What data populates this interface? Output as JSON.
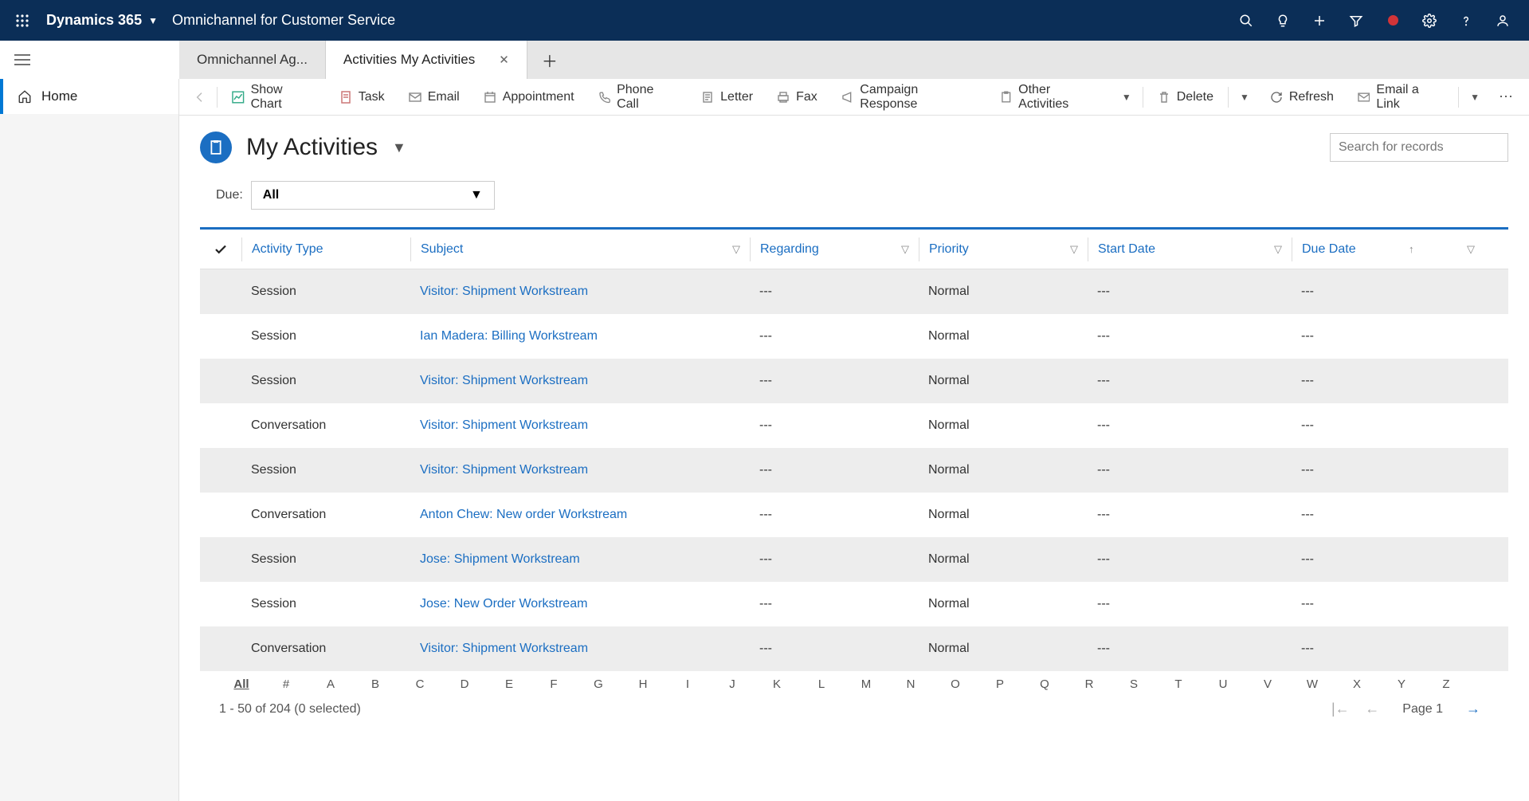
{
  "header": {
    "brand": "Dynamics 365",
    "app": "Omnichannel for Customer Service"
  },
  "tabs": {
    "inactive": "Omnichannel Ag...",
    "active": "Activities My Activities"
  },
  "sidebar": {
    "home": "Home"
  },
  "toolbar": {
    "showChart": "Show Chart",
    "task": "Task",
    "email": "Email",
    "appointment": "Appointment",
    "phoneCall": "Phone Call",
    "letter": "Letter",
    "fax": "Fax",
    "campaignResponse": "Campaign Response",
    "otherActivities": "Other Activities",
    "delete": "Delete",
    "refresh": "Refresh",
    "emailLink": "Email a Link"
  },
  "page": {
    "title": "My Activities",
    "searchPlaceholder": "Search for records",
    "dueLabel": "Due:",
    "dueValue": "All"
  },
  "columns": {
    "activityType": "Activity Type",
    "subject": "Subject",
    "regarding": "Regarding",
    "priority": "Priority",
    "startDate": "Start Date",
    "dueDate": "Due Date"
  },
  "rows": [
    {
      "type": "Session",
      "subject": "Visitor: Shipment Workstream",
      "regarding": "---",
      "priority": "Normal",
      "start": "---",
      "due": "---"
    },
    {
      "type": "Session",
      "subject": "Ian Madera: Billing Workstream",
      "regarding": "---",
      "priority": "Normal",
      "start": "---",
      "due": "---"
    },
    {
      "type": "Session",
      "subject": "Visitor: Shipment Workstream",
      "regarding": "---",
      "priority": "Normal",
      "start": "---",
      "due": "---"
    },
    {
      "type": "Conversation",
      "subject": "Visitor: Shipment Workstream",
      "regarding": "---",
      "priority": "Normal",
      "start": "---",
      "due": "---"
    },
    {
      "type": "Session",
      "subject": "Visitor: Shipment Workstream",
      "regarding": "---",
      "priority": "Normal",
      "start": "---",
      "due": "---"
    },
    {
      "type": "Conversation",
      "subject": "Anton Chew: New order Workstream",
      "regarding": "---",
      "priority": "Normal",
      "start": "---",
      "due": "---"
    },
    {
      "type": "Session",
      "subject": "Jose: Shipment Workstream",
      "regarding": "---",
      "priority": "Normal",
      "start": "---",
      "due": "---"
    },
    {
      "type": "Session",
      "subject": "Jose: New Order Workstream",
      "regarding": "---",
      "priority": "Normal",
      "start": "---",
      "due": "---"
    },
    {
      "type": "Conversation",
      "subject": "Visitor: Shipment Workstream",
      "regarding": "---",
      "priority": "Normal",
      "start": "---",
      "due": "---"
    }
  ],
  "alpha": [
    "All",
    "#",
    "A",
    "B",
    "C",
    "D",
    "E",
    "F",
    "G",
    "H",
    "I",
    "J",
    "K",
    "L",
    "M",
    "N",
    "O",
    "P",
    "Q",
    "R",
    "S",
    "T",
    "U",
    "V",
    "W",
    "X",
    "Y",
    "Z"
  ],
  "footer": {
    "status": "1 - 50 of 204 (0 selected)",
    "pageLabel": "Page 1"
  }
}
